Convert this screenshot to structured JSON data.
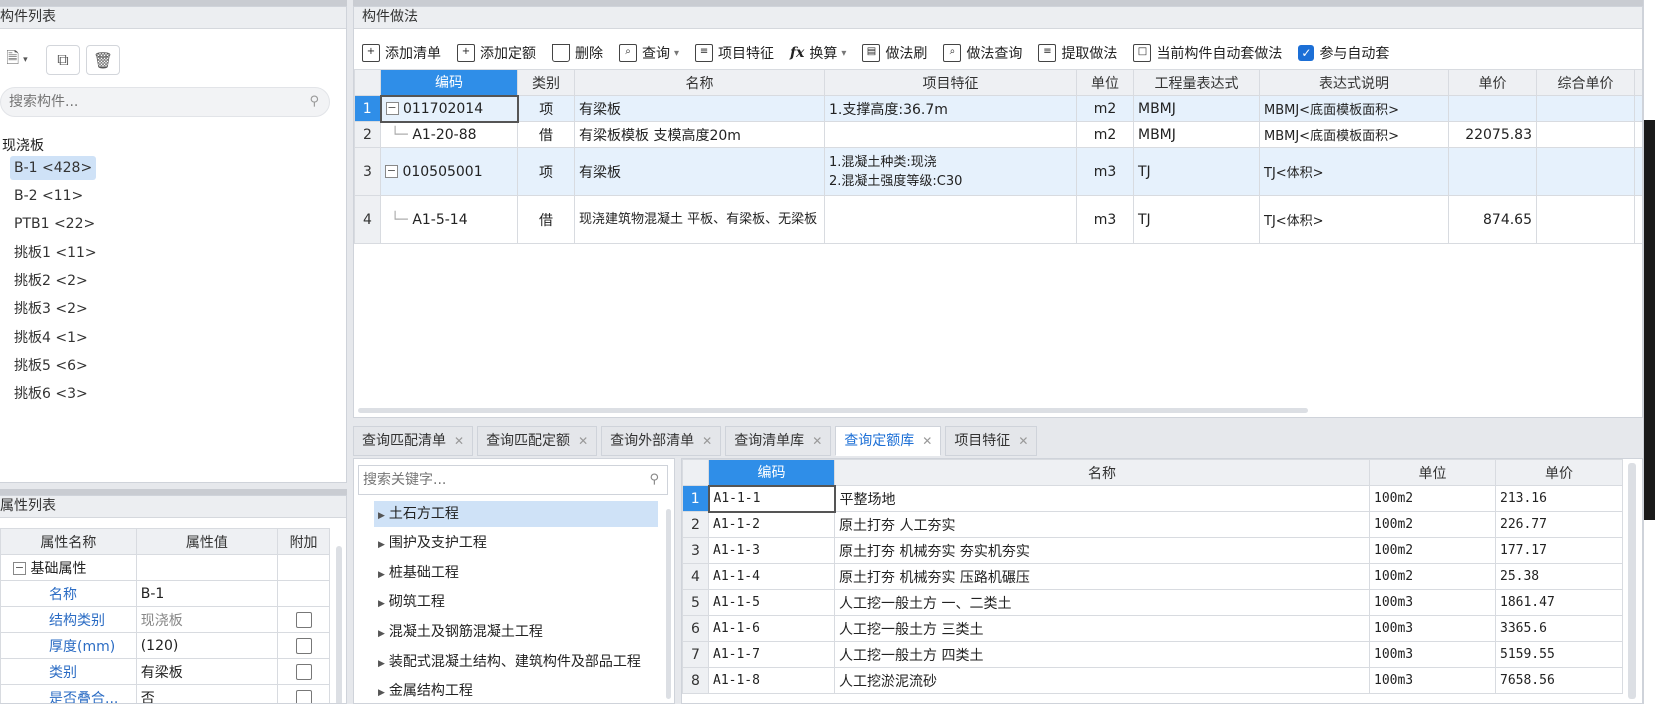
{
  "component_list": {
    "title": "构件列表",
    "search_placeholder": "搜索构件...",
    "root": "现浇板",
    "items": [
      {
        "label": "B-1 <428>"
      },
      {
        "label": "B-2 <11>"
      },
      {
        "label": "PTB1 <22>"
      },
      {
        "label": "挑板1 <11>"
      },
      {
        "label": "挑板2 <2>"
      },
      {
        "label": "挑板3 <2>"
      },
      {
        "label": "挑板4 <1>"
      },
      {
        "label": "挑板5 <6>"
      },
      {
        "label": "挑板6 <3>"
      }
    ]
  },
  "property_list": {
    "title": "属性列表",
    "headers": [
      "属性名称",
      "属性值",
      "附加"
    ],
    "group": "基础属性",
    "rows": [
      {
        "name": "名称",
        "value": "B-1"
      },
      {
        "name": "结构类别",
        "value": "现浇板"
      },
      {
        "name": "厚度(mm)",
        "value": "(120)"
      },
      {
        "name": "类别",
        "value": "有梁板"
      },
      {
        "name": "是否叠合...",
        "value": "否"
      }
    ]
  },
  "method_panel": {
    "title": "构件做法",
    "toolbar": {
      "add_bill": "添加清单",
      "add_quota": "添加定额",
      "delete": "删除",
      "query": "查询",
      "item_feature": "项目特征",
      "convert": "换算",
      "method_brush": "做法刷",
      "method_query": "做法查询",
      "extract_method": "提取做法",
      "auto_apply": "当前构件自动套做法",
      "participate_auto": "参与自动套"
    },
    "headers": [
      "编码",
      "类别",
      "名称",
      "项目特征",
      "单位",
      "工程量表达式",
      "表达式说明",
      "单价",
      "综合单价"
    ],
    "rows": [
      {
        "n": "1",
        "code": "011702014",
        "type": "项",
        "name": "有梁板",
        "feature": "1.支撑高度:36.7m",
        "unit": "m2",
        "expr": "MBMJ",
        "desc": "MBMJ<底面模板面积>",
        "price": ""
      },
      {
        "n": "2",
        "code": "A1-20-88",
        "type": "借",
        "name": "有梁板模板 支模高度20m",
        "feature": "",
        "unit": "m2",
        "expr": "MBMJ",
        "desc": "MBMJ<底面模板面积>",
        "price": "22075.83"
      },
      {
        "n": "3",
        "code": "010505001",
        "type": "项",
        "name": "有梁板",
        "feature1": "1.混凝土种类:现浇",
        "feature2": "2.混凝土强度等级:C30",
        "unit": "m3",
        "expr": "TJ",
        "desc": "TJ<体积>",
        "price": ""
      },
      {
        "n": "4",
        "code": "A1-5-14",
        "type": "借",
        "name": "现浇建筑物混凝土 平板、有梁板、无梁板",
        "feature": "",
        "unit": "m3",
        "expr": "TJ",
        "desc": "TJ<体积>",
        "price": "874.65"
      }
    ]
  },
  "tabs": [
    {
      "label": "查询匹配清单"
    },
    {
      "label": "查询匹配定额"
    },
    {
      "label": "查询外部清单"
    },
    {
      "label": "查询清单库"
    },
    {
      "label": "查询定额库",
      "active": true
    },
    {
      "label": "项目特征"
    }
  ],
  "quota_categories": {
    "search_placeholder": "搜索关键字...",
    "items": [
      "土石方工程",
      "围护及支护工程",
      "桩基础工程",
      "砌筑工程",
      "混凝土及钢筋混凝土工程",
      "装配式混凝土结构、建筑构件及部品工程",
      "金属结构工程"
    ]
  },
  "quota_table": {
    "headers": [
      "编码",
      "名称",
      "单位",
      "单价"
    ],
    "rows": [
      {
        "n": "1",
        "code": "A1-1-1",
        "name": "平整场地",
        "unit": "100m2",
        "price": "213.16"
      },
      {
        "n": "2",
        "code": "A1-1-2",
        "name": "原土打夯 人工夯实",
        "unit": "100m2",
        "price": "226.77"
      },
      {
        "n": "3",
        "code": "A1-1-3",
        "name": "原土打夯 机械夯实 夯实机夯实",
        "unit": "100m2",
        "price": "177.17"
      },
      {
        "n": "4",
        "code": "A1-1-4",
        "name": "原土打夯 机械夯实 压路机碾压",
        "unit": "100m2",
        "price": "25.38"
      },
      {
        "n": "5",
        "code": "A1-1-5",
        "name": "人工挖一般土方 一、二类土",
        "unit": "100m3",
        "price": "1861.47"
      },
      {
        "n": "6",
        "code": "A1-1-6",
        "name": "人工挖一般土方 三类土",
        "unit": "100m3",
        "price": "3365.6"
      },
      {
        "n": "7",
        "code": "A1-1-7",
        "name": "人工挖一般土方 四类土",
        "unit": "100m3",
        "price": "5159.55"
      },
      {
        "n": "8",
        "code": "A1-1-8",
        "name": "人工挖淤泥流砂",
        "unit": "100m3",
        "price": "7658.56"
      }
    ]
  },
  "colors": {
    "accent": "#2f8ee8",
    "selected": "#cfe2f7",
    "row_highlight": "#e6f1fc"
  }
}
